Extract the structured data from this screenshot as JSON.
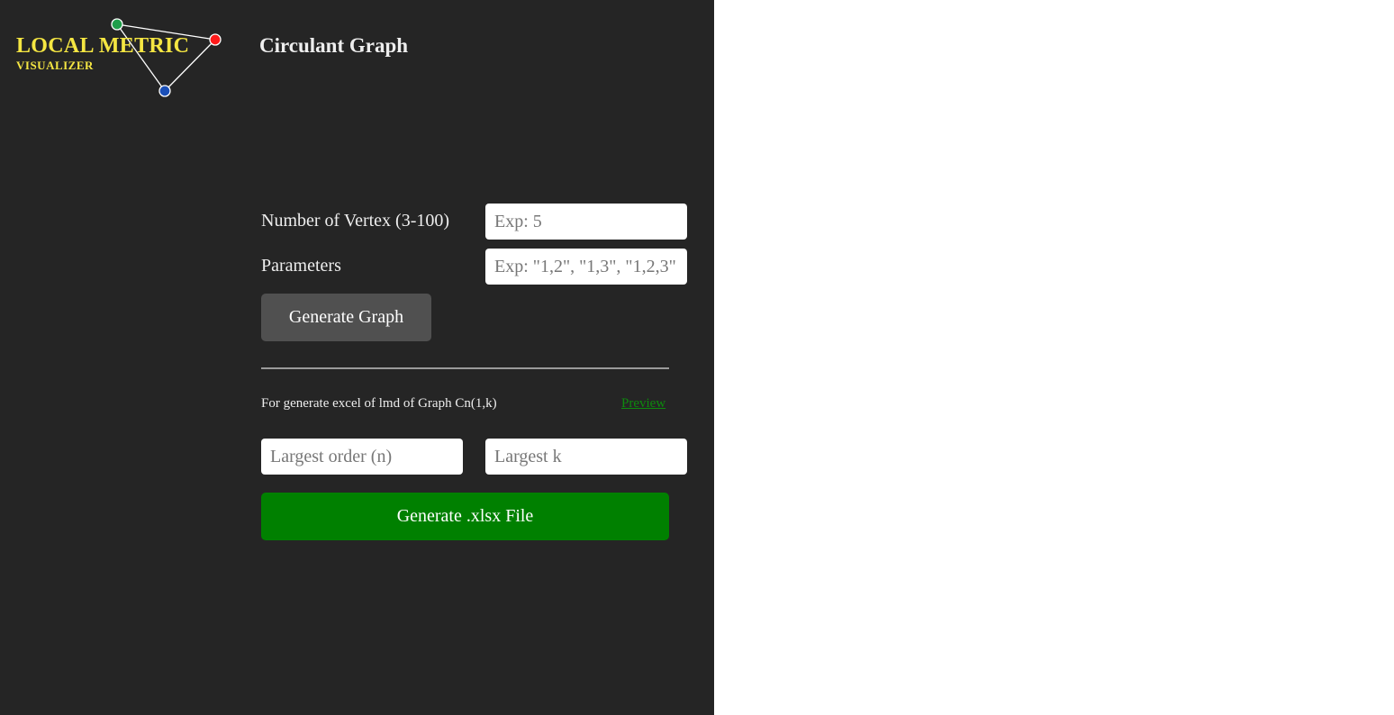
{
  "logo": {
    "title": "LOCAL METRIC",
    "subtitle": "VISUALIZER",
    "title_color": "#f5e642",
    "node_colors": [
      "#1f9e4a",
      "#ff1a1a",
      "#1a4fb8"
    ]
  },
  "page": {
    "title": "Circulant Graph"
  },
  "form": {
    "vertex_label": "Number of Vertex (3-100)",
    "vertex_placeholder": "Exp: 5",
    "vertex_value": "",
    "params_label": "Parameters",
    "params_placeholder": "Exp: \"1,2\", \"1,3\", \"1,2,3\"",
    "params_value": "",
    "generate_label": "Generate Graph"
  },
  "excel": {
    "note": "For generate excel of lmd of Graph Cn(1,k)",
    "preview_label": "Preview",
    "largest_n_placeholder": "Largest order (n)",
    "largest_k_placeholder": "Largest k",
    "generate_xlsx_label": "Generate .xlsx File"
  },
  "colors": {
    "sidebar_bg": "#252525",
    "primary_green": "#008000",
    "secondary_button": "#505050",
    "link_green": "#0d8a0d"
  }
}
